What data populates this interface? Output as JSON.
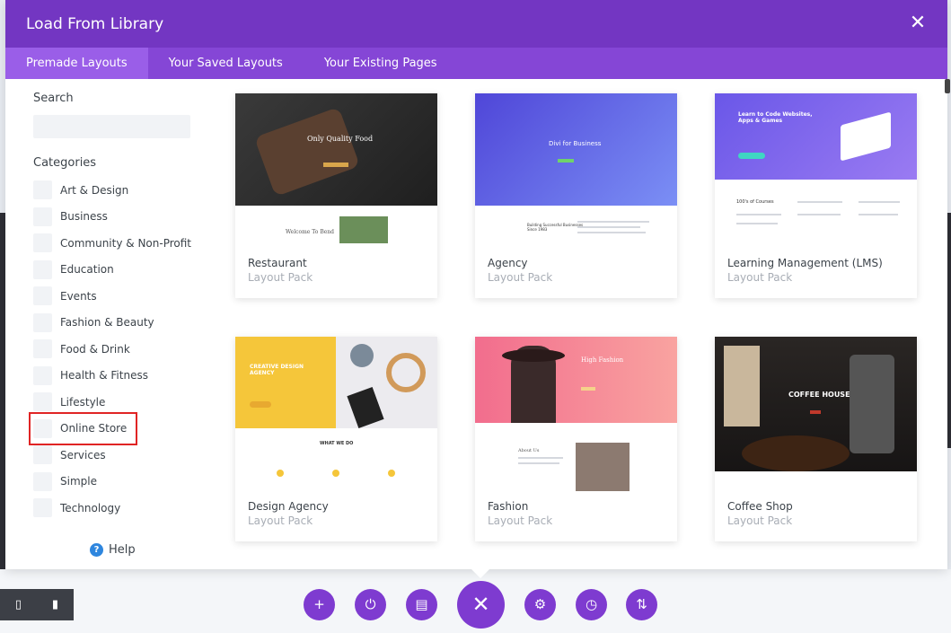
{
  "modal": {
    "title": "Load From Library",
    "close_icon": "close-icon"
  },
  "tabs": [
    {
      "label": "Premade Layouts",
      "active": true
    },
    {
      "label": "Your Saved Layouts",
      "active": false
    },
    {
      "label": "Your Existing Pages",
      "active": false
    }
  ],
  "sidebar": {
    "search_label": "Search",
    "search_value": "",
    "categories_label": "Categories",
    "categories": [
      "Art & Design",
      "Business",
      "Community & Non-Profit",
      "Education",
      "Events",
      "Fashion & Beauty",
      "Food & Drink",
      "Health & Fitness",
      "Lifestyle",
      "Online Store",
      "Services",
      "Simple",
      "Technology"
    ],
    "help_label": "Help"
  },
  "layouts": [
    {
      "name": "Restaurant",
      "type": "Layout Pack",
      "hero_text": "Only Quality Food",
      "sub_text": "Welcome To Bend",
      "colors": [
        "#2b2b2b",
        "#5a4a3a"
      ]
    },
    {
      "name": "Agency",
      "type": "Layout Pack",
      "hero_text": "Divi for Business",
      "sub_text": "Building Successful Businesses Since 1983",
      "colors": [
        "#5b4fd6",
        "#7a8ff0"
      ]
    },
    {
      "name": "Learning Management (LMS)",
      "type": "Layout Pack",
      "hero_text": "Learn to Code Websites, Apps & Games",
      "sub_text": "100's of Courses",
      "colors": [
        "#6a57e8",
        "#9a7bf2"
      ]
    },
    {
      "name": "Design Agency",
      "type": "Layout Pack",
      "hero_text": "CREATIVE DESIGN AGENCY",
      "sub_text": "WHAT WE DO",
      "colors": [
        "#f5c63a",
        "#e9e9ec"
      ]
    },
    {
      "name": "Fashion",
      "type": "Layout Pack",
      "hero_text": "High Fashion",
      "sub_text": "About Us",
      "colors": [
        "#f26d8d",
        "#f9a3a0"
      ]
    },
    {
      "name": "Coffee Shop",
      "type": "Layout Pack",
      "hero_text": "COFFEE HOUSE",
      "sub_text": "",
      "colors": [
        "#1e1e1e",
        "#3a3634"
      ]
    }
  ],
  "toolbar": {
    "view_icons": [
      "desktop-icon",
      "mobile-icon"
    ],
    "buttons": [
      "add-icon",
      "power-icon",
      "trash-icon",
      "close-icon",
      "gear-icon",
      "history-icon",
      "sort-icon"
    ]
  },
  "accent_color": "#7e3bd0"
}
